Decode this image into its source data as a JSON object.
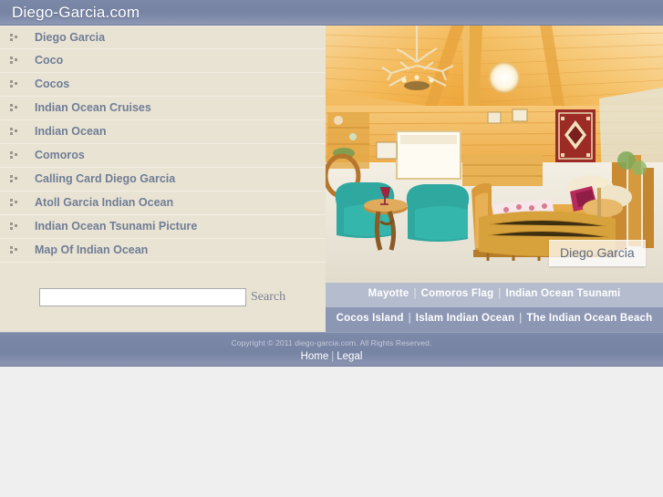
{
  "header": {
    "title": "Diego-Garcia.com"
  },
  "sidebar": {
    "items": [
      {
        "label": "Diego Garcia",
        "icon": "bullet-icon"
      },
      {
        "label": "Coco",
        "icon": "bullet-icon"
      },
      {
        "label": "Cocos",
        "icon": "bullet-icon"
      },
      {
        "label": "Indian Ocean Cruises",
        "icon": "bullet-icon"
      },
      {
        "label": "Indian Ocean",
        "icon": "bullet-icon"
      },
      {
        "label": "Comoros",
        "icon": "bullet-icon"
      },
      {
        "label": "Calling Card Diego Garcia",
        "icon": "bullet-icon"
      },
      {
        "label": "Atoll Garcia Indian Ocean",
        "icon": "bullet-icon"
      },
      {
        "label": "Indian Ocean Tsunami Picture",
        "icon": "bullet-icon"
      },
      {
        "label": "Map Of Indian Ocean",
        "icon": "bullet-icon"
      }
    ]
  },
  "search": {
    "value": "",
    "placeholder": "",
    "button_label": "Search"
  },
  "hero": {
    "caption": "Diego Garcia",
    "alt": "Log cabin bedroom interior with antler chandelier, vaulted pine ceiling, teal armchairs and a log bed"
  },
  "linkbars": [
    {
      "separator": "|",
      "links": [
        "Mayotte",
        "Comoros Flag",
        "Indian Ocean Tsunami"
      ]
    },
    {
      "separator": "|",
      "links": [
        "Cocos Island",
        "Islam Indian Ocean",
        "The Indian Ocean Beach"
      ]
    }
  ],
  "footer": {
    "copyright": "Copyright © 2011 diego-garcia.com. All Rights Reserved.",
    "separator": "|",
    "links": [
      "Home",
      "Legal"
    ]
  },
  "colors": {
    "header_blue": "#7783a3",
    "sidebar_beige": "#e9e3d3",
    "nav_text": "#707d96",
    "linkbar_light": "#b4bccd",
    "linkbar_dark": "#8c97b4",
    "page_background": "#efefef"
  }
}
